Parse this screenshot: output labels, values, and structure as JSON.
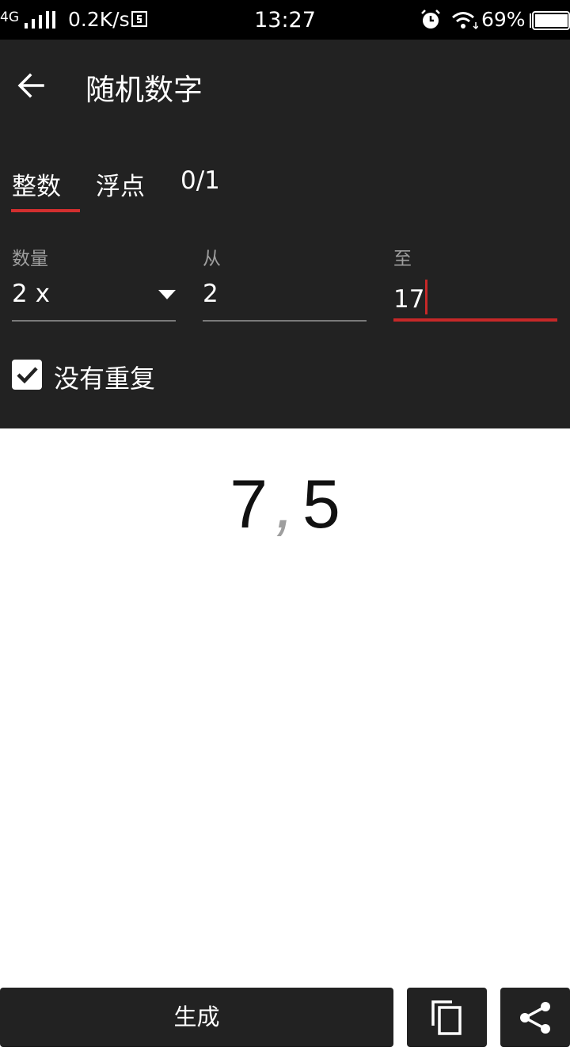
{
  "status_bar": {
    "network": "4G",
    "speed": "0.2K/s",
    "time": "13:27",
    "battery": "69%"
  },
  "app_bar": {
    "title": "随机数字",
    "back_icon": "arrow-left-icon"
  },
  "tabs": [
    {
      "label": "整数",
      "selected": true
    },
    {
      "label": "浮点",
      "selected": false
    },
    {
      "label": "0/1",
      "selected": false
    }
  ],
  "fields": {
    "quantity": {
      "label": "数量",
      "value": "2 x"
    },
    "from": {
      "label": "从",
      "value": "2"
    },
    "to": {
      "label": "至",
      "value": "17"
    }
  },
  "no_repeat": {
    "label": "没有重复",
    "checked": true
  },
  "result": {
    "values": [
      "7",
      "5"
    ],
    "separator": ","
  },
  "actions": {
    "generate_label": "生成",
    "copy_icon": "copy-icon",
    "share_icon": "share-icon"
  },
  "colors": {
    "header_bg": "#222222",
    "accent": "#c62828",
    "status_bar_bg": "#000000"
  }
}
